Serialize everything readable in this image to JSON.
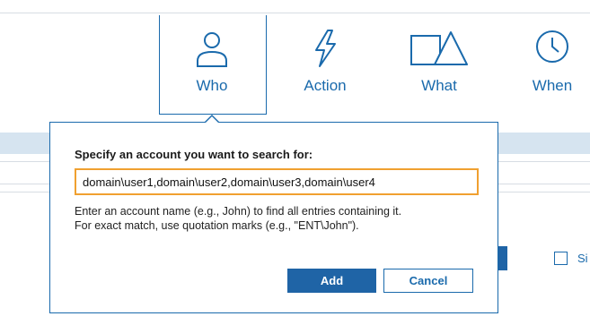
{
  "tabs": [
    {
      "label": "Who",
      "icon": "person-icon"
    },
    {
      "label": "Action",
      "icon": "lightning-icon"
    },
    {
      "label": "What",
      "icon": "shapes-icon"
    },
    {
      "label": "When",
      "icon": "clock-icon"
    }
  ],
  "dialog": {
    "title": "Specify an account you want to search for:",
    "input_value": "domain\\user1,domain\\user2,domain\\user3,domain\\user4",
    "hint_line1": "Enter an account name (e.g., John) to find all entries containing it.",
    "hint_line2": "For exact match, use quotation marks (e.g., \"ENT\\John\").",
    "add_label": "Add",
    "cancel_label": "Cancel"
  },
  "background": {
    "partial_label": "Si"
  },
  "colors": {
    "accent": "#1a6aac",
    "button": "#1f64a6",
    "input_focus": "#f0a030",
    "band": "#d6e4f0"
  }
}
